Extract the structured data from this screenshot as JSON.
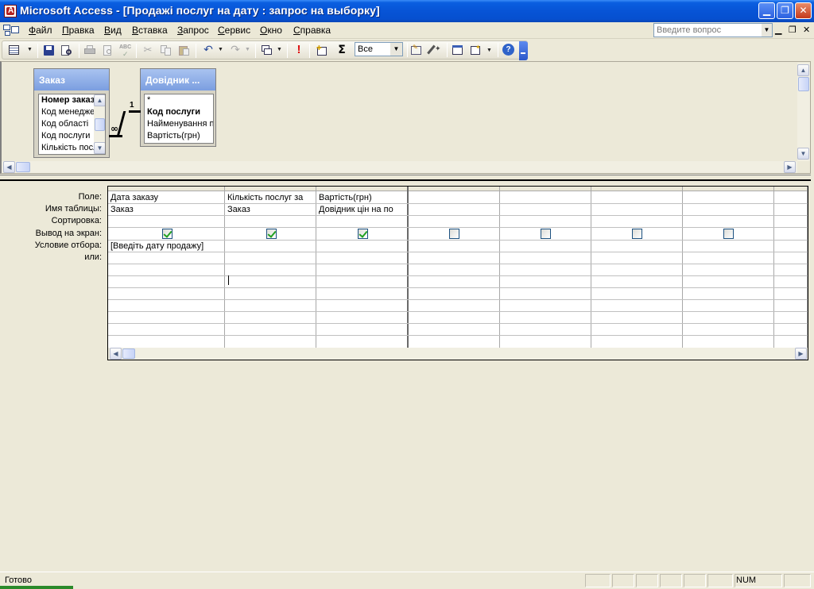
{
  "window": {
    "title": "Microsoft Access - [Продажі послуг на дату : запрос на выборку]"
  },
  "menu": {
    "items": [
      "Файл",
      "Правка",
      "Вид",
      "Вставка",
      "Запрос",
      "Сервис",
      "Окно",
      "Справка"
    ],
    "ask_placeholder": "Введите вопрос"
  },
  "toolbar": {
    "top_values_value": "Все",
    "sigma_label": "Σ",
    "exclaim_label": "!"
  },
  "tables": [
    {
      "title": "Заказ",
      "fields": [
        {
          "name": "Номер заказу",
          "key": true
        },
        {
          "name": "Код менеджера",
          "key": false
        },
        {
          "name": "Код області",
          "key": false
        },
        {
          "name": "Код послуги",
          "key": false
        },
        {
          "name": "Кількість послуг",
          "key": false
        }
      ]
    },
    {
      "title": "Довідник ...",
      "fields": [
        {
          "name": "*",
          "key": false
        },
        {
          "name": "Код послуги",
          "key": true
        },
        {
          "name": "Найменування послуги",
          "key": false
        },
        {
          "name": "Вартість(грн)",
          "key": false
        }
      ]
    }
  ],
  "relationship": {
    "one_label": "1",
    "many_label": "∞"
  },
  "grid": {
    "row_labels": [
      "Поле:",
      "Имя таблицы:",
      "Сортировка:",
      "Вывод на экран:",
      "Условие отбора:",
      "или:"
    ],
    "columns": [
      {
        "field": "Дата заказу",
        "table": "Заказ",
        "sort": "",
        "show": true,
        "criteria": "[Введіть дату продажу]"
      },
      {
        "field": "Кількість послуг за",
        "table": "Заказ",
        "sort": "",
        "show": true,
        "criteria": ""
      },
      {
        "field": "Вартість(грн)",
        "table": "Довідник цін на по",
        "sort": "",
        "show": true,
        "criteria": ""
      },
      {
        "field": "",
        "table": "",
        "sort": "",
        "show": false,
        "criteria": ""
      },
      {
        "field": "",
        "table": "",
        "sort": "",
        "show": false,
        "criteria": ""
      },
      {
        "field": "",
        "table": "",
        "sort": "",
        "show": false,
        "criteria": ""
      },
      {
        "field": "",
        "table": "",
        "sort": "",
        "show": false,
        "criteria": ""
      },
      {
        "field": "",
        "table": "",
        "sort": "",
        "show": false,
        "criteria": ""
      }
    ]
  },
  "status": {
    "text": "Готово",
    "num_indicator": "NUM"
  },
  "colors": {
    "title_bar": "#0754d6",
    "table_header": "#7b9ee0",
    "check_mark": "#21a121"
  }
}
